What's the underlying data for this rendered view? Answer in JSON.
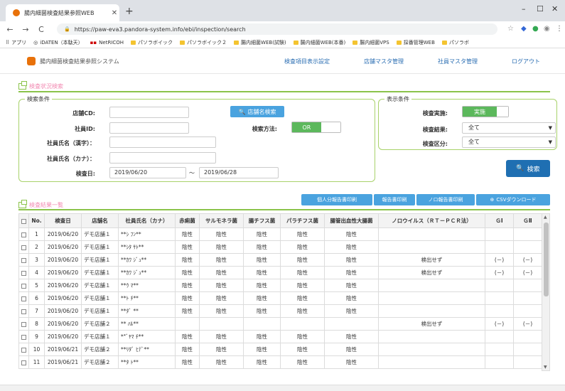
{
  "browser": {
    "tab_title": "腸内細菌検査結果参照WEB",
    "url": "https://paw-eva3.pandora-system.info/ebi/inspection/search",
    "bookmarks": [
      "アプリ",
      "iDATEN（本駄天）",
      "NetRICOH",
      "パソラボイック",
      "パソラボイック２",
      "腸内細菌WEB(試験)",
      "腸内細菌WEB(本番)",
      "腸内細菌VPS",
      "採番管理WEB",
      "パソラボ"
    ]
  },
  "app": {
    "name": "腸内細菌検査結果参照システム",
    "nav": [
      "検査項目表示設定",
      "店舗マスタ管理",
      "社員マスタ管理",
      "ログアウト"
    ]
  },
  "search_section": {
    "title": "検査状況検索",
    "criteria_legend": "検索条件",
    "labels": {
      "store_cd": "店舗CD:",
      "employee_id": "社員ID:",
      "name_kanji": "社員氏名（漢字）：",
      "name_kana": "社員氏名（カナ）：",
      "inspection_date": "検査日:",
      "search_method": "検索方法:"
    },
    "store_search_button": "店舗名検索",
    "search_method_value": "OR",
    "date_from": "2019/06/20",
    "date_sep": "～",
    "date_to": "2019/06/28",
    "display_legend": "表示条件",
    "display_labels": {
      "implemented": "検査実施:",
      "result": "検査結果:",
      "category": "検査区分:"
    },
    "implemented_value": "実施",
    "result_value": "全て",
    "category_value": "全て",
    "search_button": "検索"
  },
  "results_section": {
    "title": "検査結果一覧",
    "buttons": [
      "個人分報告書印刷",
      "報告書印刷",
      "ノロ報告書印刷",
      "CSVダウンロード"
    ],
    "columns": [
      "",
      "No.",
      "検査日",
      "店舗名",
      "社員氏名（カナ）",
      "赤痢菌",
      "サルモネラ菌",
      "腸チフス菌",
      "パラチフス菌",
      "腸管出血性大腸菌",
      "ノロウイルス（ＲＴ－ＰＣＲ法）",
      "ＧⅠ",
      "ＧⅡ"
    ],
    "rows": [
      [
        "",
        "1",
        "2019/06/20",
        "デモ店舗１",
        "**ｼ ﾌﾝ**",
        "陰性",
        "陰性",
        "陰性",
        "陰性",
        "陰性",
        "",
        "",
        ""
      ],
      [
        "",
        "2",
        "2019/06/20",
        "デモ店舗１",
        "**ｼﾀ ｻﾄ**",
        "陰性",
        "陰性",
        "陰性",
        "陰性",
        "陰性",
        "",
        "",
        ""
      ],
      [
        "",
        "3",
        "2019/06/20",
        "デモ店舗１",
        "**ｶﾜ ｼﾞｭ**",
        "陰性",
        "陰性",
        "陰性",
        "陰性",
        "陰性",
        "検出せず",
        "(－)",
        "(－)"
      ],
      [
        "",
        "4",
        "2019/06/20",
        "デモ店舗１",
        "**ｶﾜ ｼﾞｭ**",
        "陰性",
        "陰性",
        "陰性",
        "陰性",
        "陰性",
        "検出せず",
        "(－)",
        "(－)"
      ],
      [
        "",
        "5",
        "2019/06/20",
        "デモ店舗１",
        "**ｳ ﾏ**",
        "陰性",
        "陰性",
        "陰性",
        "陰性",
        "陰性",
        "",
        "",
        ""
      ],
      [
        "",
        "6",
        "2019/06/20",
        "デモ店舗１",
        "**ﾄ ﾁ**",
        "陰性",
        "陰性",
        "陰性",
        "陰性",
        "陰性",
        "",
        "",
        ""
      ],
      [
        "",
        "7",
        "2019/06/20",
        "デモ店舗１",
        "**ﾀﾞ **",
        "陰性",
        "陰性",
        "陰性",
        "陰性",
        "陰性",
        "",
        "",
        ""
      ],
      [
        "",
        "8",
        "2019/06/20",
        "デモ店舗２",
        "** ﾊﾙ**",
        "",
        "",
        "",
        "",
        "",
        "検出せず",
        "(－)",
        "(－)"
      ],
      [
        "",
        "9",
        "2019/06/20",
        "デモ店舗１",
        "**ﾞﾔﾏ ﾁ**",
        "陰性",
        "陰性",
        "陰性",
        "陰性",
        "陰性",
        "",
        "",
        ""
      ],
      [
        "",
        "10",
        "2019/06/21",
        "デモ店舗２",
        "**ﾘﾀﾞ ﾋﾃﾞ**",
        "陰性",
        "陰性",
        "陰性",
        "陰性",
        "陰性",
        "",
        "",
        ""
      ],
      [
        "",
        "11",
        "2019/06/21",
        "デモ店舗２",
        "**ﾀ ﾄ**",
        "陰性",
        "陰性",
        "陰性",
        "陰性",
        "陰性",
        "",
        "",
        ""
      ]
    ]
  }
}
